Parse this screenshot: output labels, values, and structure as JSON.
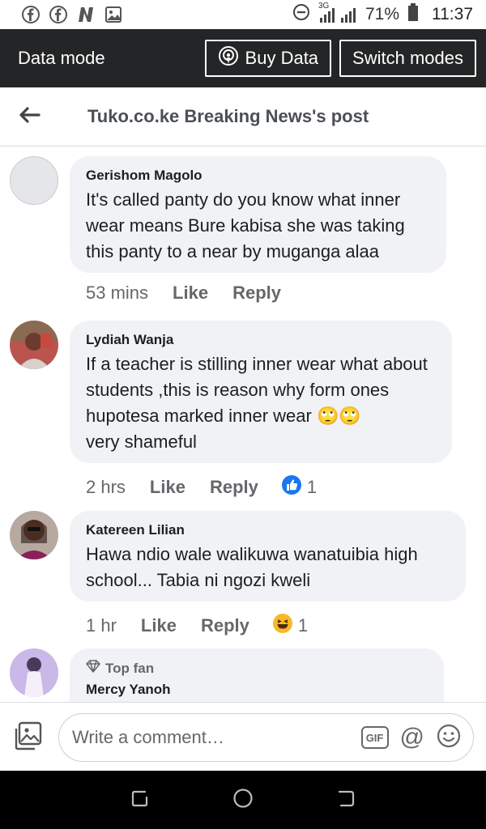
{
  "status_bar": {
    "icons_left": [
      "facebook-icon",
      "facebook-icon",
      "notification-n-icon",
      "gallery-icon"
    ],
    "network": "3G",
    "battery": "71%",
    "time": "11:37"
  },
  "data_bar": {
    "label": "Data mode",
    "buy_data": "Buy Data",
    "switch_modes": "Switch modes"
  },
  "header": {
    "title": "Tuko.co.ke Breaking News's post"
  },
  "comments": [
    {
      "author": "Gerishom Magolo",
      "text": "It's called panty do you know what inner wear means Bure kabisa she was taking this panty to a near by muganga alaa",
      "time": "53 mins",
      "like": "Like",
      "reply": "Reply"
    },
    {
      "author": "Lydiah Wanja",
      "text": "If a teacher is stilling inner wear what about students ,this is reason why form ones hupotesa marked inner wear",
      "text_tail": "very shameful",
      "emoji": "🙄🙄",
      "time": "2 hrs",
      "like": "Like",
      "reply": "Reply",
      "reaction_icon": "like-reaction-icon",
      "reaction_count": "1"
    },
    {
      "author": "Katereen Lilian",
      "text": "Hawa ndio wale walikuwa wanatuibia high school... Tabia ni ngozi kweli",
      "time": "1 hr",
      "like": "Like",
      "reply": "Reply",
      "reaction_icon": "haha-reaction-icon",
      "reaction_count": "1"
    },
    {
      "badge": "Top fan",
      "author": "Mercy  Yanoh"
    }
  ],
  "composer": {
    "placeholder": "Write a comment…",
    "gif": "GIF"
  },
  "colors": {
    "bubble": "#f0f2f5",
    "dark_bar": "#242526",
    "like_blue": "#1877f2",
    "muted": "#65676b"
  }
}
